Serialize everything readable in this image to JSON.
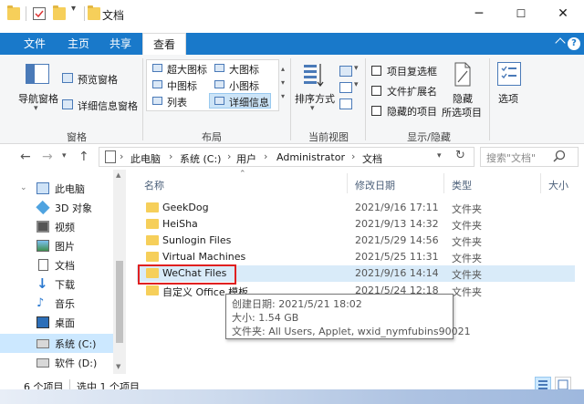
{
  "window": {
    "title": "文档",
    "controls": [
      "─",
      "☐",
      "✕"
    ]
  },
  "ribbon_tabs": [
    "文件",
    "主页",
    "共享",
    "查看"
  ],
  "ribbon": {
    "panes": {
      "nav_pane": "导航窗格",
      "preview": "预览窗格",
      "details": "详细信息窗格",
      "group": "窗格"
    },
    "layout": {
      "items": [
        "超大图标",
        "大图标",
        "中图标",
        "小图标",
        "列表",
        "详细信息"
      ],
      "group": "布局"
    },
    "current_view": {
      "sort": "排序方式",
      "group": "当前视图"
    },
    "show_hide": {
      "checkboxes": [
        "项目复选框",
        "文件扩展名",
        "隐藏的项目"
      ],
      "hide_selected_line1": "隐藏",
      "hide_selected_line2": "所选项目",
      "group": "显示/隐藏"
    },
    "options": "选项"
  },
  "address": {
    "crumbs": [
      "此电脑",
      "系统 (C:)",
      "用户",
      "Administrator",
      "文档"
    ],
    "search_placeholder": "搜索\"文档\""
  },
  "nav_pane": {
    "items": [
      {
        "label": "此电脑",
        "icon": "pc-icon"
      },
      {
        "label": "3D 对象",
        "icon": "3d-objects-icon"
      },
      {
        "label": "视频",
        "icon": "video-icon"
      },
      {
        "label": "图片",
        "icon": "pictures-icon"
      },
      {
        "label": "文档",
        "icon": "documents-icon"
      },
      {
        "label": "下载",
        "icon": "download-icon"
      },
      {
        "label": "音乐",
        "icon": "music-icon"
      },
      {
        "label": "桌面",
        "icon": "desktop-icon"
      },
      {
        "label": "系统 (C:)",
        "icon": "drive-c-icon"
      },
      {
        "label": "软件 (D:)",
        "icon": "drive-d-icon"
      }
    ]
  },
  "columns": [
    "名称",
    "修改日期",
    "类型",
    "大小"
  ],
  "files": [
    {
      "name": "GeekDog",
      "date": "2021/9/16 17:11",
      "type": "文件夹"
    },
    {
      "name": "HeiSha",
      "date": "2021/9/13 14:32",
      "type": "文件夹"
    },
    {
      "name": "Sunlogin Files",
      "date": "2021/5/29 14:56",
      "type": "文件夹"
    },
    {
      "name": "Virtual Machines",
      "date": "2021/5/25 11:31",
      "type": "文件夹"
    },
    {
      "name": "WeChat Files",
      "date": "2021/9/16 14:14",
      "type": "文件夹"
    },
    {
      "name": "自定义 Office 模板",
      "date": "2021/5/24 12:18",
      "type": "文件夹"
    }
  ],
  "tooltip": {
    "line1": "创建日期: 2021/5/21 18:02",
    "line2": "大小: 1.54 GB",
    "line3": "文件夹: All Users, Applet, wxid_nymfubins90021"
  },
  "status": {
    "count": "6 个项目",
    "selected": "选中 1 个项目"
  },
  "colors": {
    "ribbon_blue": "#1979ca",
    "folder": "#f6cf5a",
    "highlight_red": "#e02020"
  }
}
